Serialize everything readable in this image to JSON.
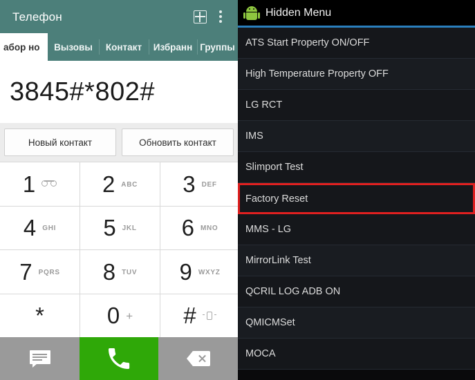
{
  "phone": {
    "titlebar": {
      "title": "Телефон",
      "keypad_icon": "grid-keypad-icon",
      "overflow_icon": "more-vertical-icon"
    },
    "tabs": [
      {
        "label": "абор но",
        "active": true
      },
      {
        "label": "Вызовы",
        "active": false
      },
      {
        "label": "Контакт",
        "active": false
      },
      {
        "label": "Избранн",
        "active": false
      },
      {
        "label": "Группы",
        "active": false
      }
    ],
    "dialed_number": "3845#*802#",
    "actions": {
      "new_contact": "Новый контакт",
      "update_contact": "Обновить контакт"
    },
    "keypad": [
      {
        "digit": "1",
        "sub": "",
        "icon": "voicemail-icon"
      },
      {
        "digit": "2",
        "sub": "ABC",
        "icon": ""
      },
      {
        "digit": "3",
        "sub": "DEF",
        "icon": ""
      },
      {
        "digit": "4",
        "sub": "GHI",
        "icon": ""
      },
      {
        "digit": "5",
        "sub": "JKL",
        "icon": ""
      },
      {
        "digit": "6",
        "sub": "MNO",
        "icon": ""
      },
      {
        "digit": "7",
        "sub": "PQRS",
        "icon": ""
      },
      {
        "digit": "8",
        "sub": "TUV",
        "icon": ""
      },
      {
        "digit": "9",
        "sub": "WXYZ",
        "icon": ""
      },
      {
        "digit": "*",
        "sub": "",
        "icon": ""
      },
      {
        "digit": "0",
        "sub": "+",
        "icon": ""
      },
      {
        "digit": "#",
        "sub": "",
        "icon": "vibrate-icon"
      }
    ],
    "bottom_bar": {
      "message_icon": "message-icon",
      "call_icon": "call-icon",
      "delete_icon": "backspace-icon"
    },
    "colors": {
      "titlebar": "#4c7f7a",
      "call_button": "#2fa808",
      "bottom_bar": "#9a9a9a"
    }
  },
  "hidden_menu": {
    "header": {
      "title": "Hidden Menu",
      "icon": "android-robot-icon",
      "accent_color": "#2a7fbd"
    },
    "items": [
      {
        "label": "ATS Start Property ON/OFF",
        "highlighted": false
      },
      {
        "label": "High Temperature Property OFF",
        "highlighted": false
      },
      {
        "label": "LG RCT",
        "highlighted": false
      },
      {
        "label": "IMS",
        "highlighted": false
      },
      {
        "label": "Slimport Test",
        "highlighted": false
      },
      {
        "label": "Factory Reset",
        "highlighted": true
      },
      {
        "label": "MMS - LG",
        "highlighted": false
      },
      {
        "label": "MirrorLink Test",
        "highlighted": false
      },
      {
        "label": "QCRIL LOG ADB ON",
        "highlighted": false
      },
      {
        "label": "QMICMSet",
        "highlighted": false
      },
      {
        "label": "MOCA",
        "highlighted": false
      }
    ],
    "colors": {
      "background": "#0a0a0c",
      "highlight_border": "#e02020"
    }
  }
}
